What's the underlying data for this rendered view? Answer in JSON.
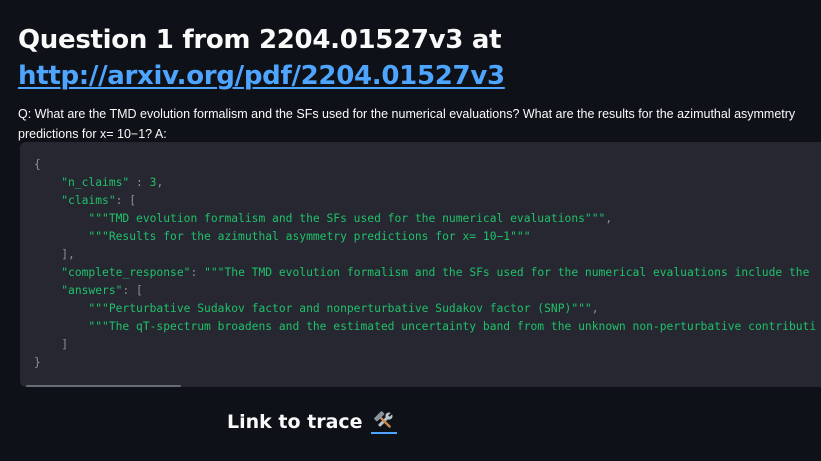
{
  "header": {
    "title_prefix": "Question 1 from 2204.01527v3 at ",
    "link_text": "http://arxiv.org/pdf/2204.01527v3"
  },
  "question_text": "Q: What are the TMD evolution formalism and the SFs used for the numerical evaluations? What are the results for the azimuthal asymmetry predictions for x= 10−1? A:",
  "code": {
    "open_brace": "{",
    "n_claims_key": "\"n_claims\"",
    "n_claims_sep": " : ",
    "n_claims_value": "3",
    "comma": ",",
    "claims_key": "\"claims\"",
    "colon": ": ",
    "open_bracket": "[",
    "claim_1": "\"\"\"TMD evolution formalism and the SFs used for the numerical evaluations\"\"\"",
    "claim_2": "\"\"\"Results for the azimuthal asymmetry predictions for x= 10−1\"\"\"",
    "close_bracket_comma": "],",
    "complete_response_key": "\"complete_response\"",
    "complete_response_value": "\"\"\"The TMD evolution formalism and the SFs used for the numerical evaluations include the",
    "answers_key": "\"answers\"",
    "answer_1": "\"\"\"Perturbative Sudakov factor and nonperturbative Sudakov factor (SNP)\"\"\"",
    "answer_2": "\"\"\"The qT-spectrum broadens and the estimated uncertainty band from the unknown non-perturbative contributi",
    "close_bracket": "]",
    "close_brace": "}"
  },
  "footer": {
    "trace_link_text": "Link to trace",
    "trace_icon": "hammer-and-wrench-icon"
  }
}
